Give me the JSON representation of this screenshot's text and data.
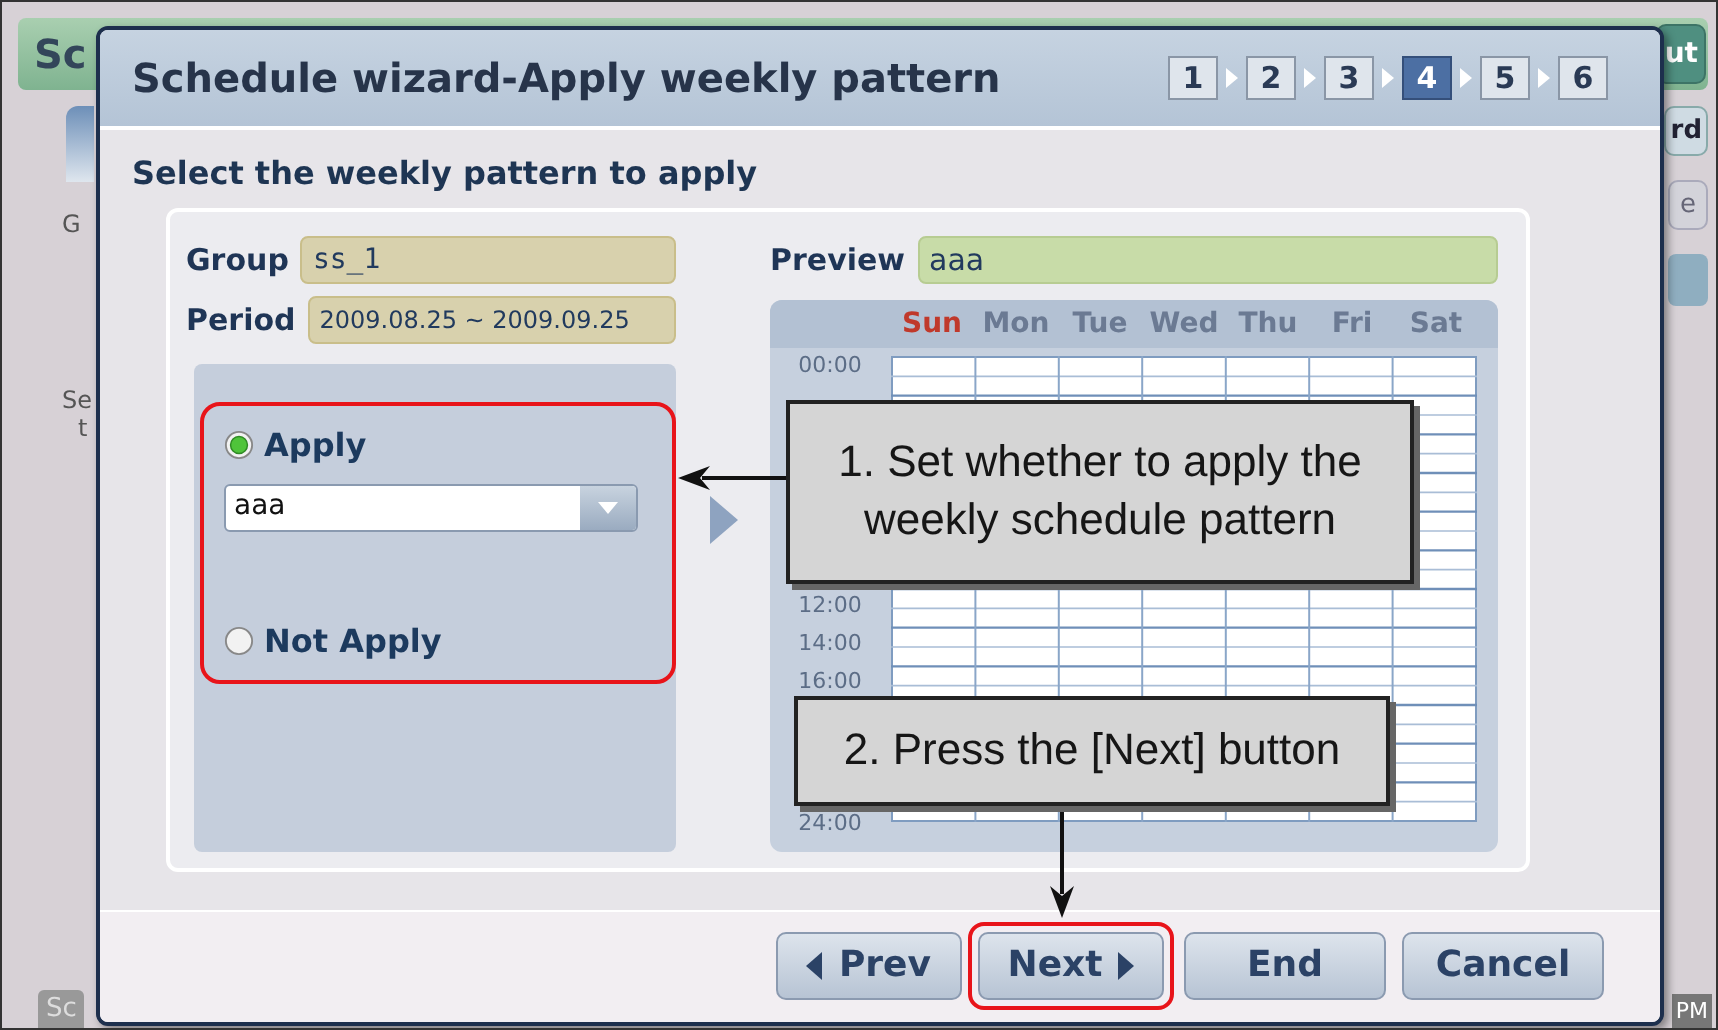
{
  "background": {
    "title": "Sc",
    "header_button": "ut",
    "side_button": "rd",
    "disabled_button": "e",
    "labels": [
      "G",
      "Se",
      "t"
    ],
    "status_left": "Sc",
    "clock": "PM"
  },
  "dialog": {
    "title": "Schedule wizard-Apply weekly pattern",
    "steps": [
      {
        "label": "1",
        "selected": false
      },
      {
        "label": "2",
        "selected": false
      },
      {
        "label": "3",
        "selected": false
      },
      {
        "label": "4",
        "selected": true
      },
      {
        "label": "5",
        "selected": false
      },
      {
        "label": "6",
        "selected": false
      }
    ],
    "subtitle": "Select the weekly pattern to apply",
    "group": {
      "label": "Group",
      "value": "ss_1"
    },
    "period": {
      "label": "Period",
      "value": "2009.08.25 ~ 2009.09.25"
    },
    "options_highlighted": true,
    "options": [
      {
        "label": "Apply",
        "selected": true,
        "dropdown": {
          "value": "aaa"
        }
      },
      {
        "label": "Not Apply",
        "selected": false
      }
    ],
    "preview": {
      "label": "Preview",
      "value": "aaa"
    },
    "days": [
      {
        "label": "Sun",
        "color": "#c0392b"
      },
      {
        "label": "Mon",
        "color": "#6b7a93"
      },
      {
        "label": "Tue",
        "color": "#6b7a93"
      },
      {
        "label": "Wed",
        "color": "#6b7a93"
      },
      {
        "label": "Thu",
        "color": "#6b7a93"
      },
      {
        "label": "Fri",
        "color": "#6b7a93"
      },
      {
        "label": "Sat",
        "color": "#6b7a93"
      }
    ],
    "time_labels": {
      "top": "00:00",
      "middle": [
        "12:00",
        "14:00",
        "16:00"
      ],
      "bottom": "24:00"
    },
    "buttons": [
      {
        "label": "Prev",
        "kind": "prev",
        "highlighted": false
      },
      {
        "label": "Next",
        "kind": "next",
        "highlighted": true
      },
      {
        "label": "End",
        "kind": "plain",
        "highlighted": false
      },
      {
        "label": "Cancel",
        "kind": "plain",
        "highlighted": false
      }
    ]
  },
  "callouts": [
    {
      "text": "1. Set whether to apply the weekly schedule pattern",
      "kind": "left"
    },
    {
      "text": "2. Press the [Next] button",
      "kind": "down"
    }
  ]
}
